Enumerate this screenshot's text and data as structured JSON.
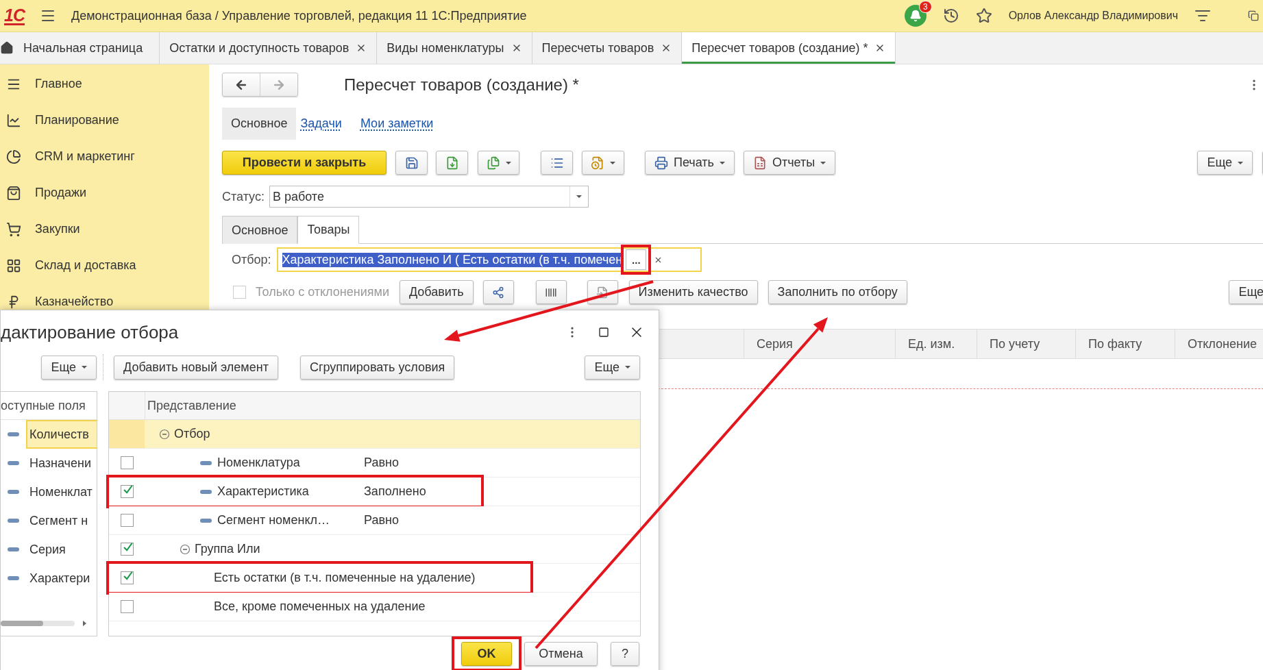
{
  "app_bar": {
    "logo": "1С",
    "title": "Демонстрационная база / Управление торговлей, редакция 11 1С:Предприятие",
    "notifications": "3",
    "user": "Орлов Александр Владимирович"
  },
  "open_tabs": [
    {
      "kind": "home",
      "label": "Начальная страница",
      "selected": false
    },
    {
      "kind": "document",
      "label": "Остатки и доступность товаров",
      "selected": false
    },
    {
      "kind": "document",
      "label": "Виды номенклатуры",
      "selected": false
    },
    {
      "kind": "document",
      "label": "Пересчеты товаров",
      "selected": false
    },
    {
      "kind": "document",
      "label": "Пересчет товаров (создание) *",
      "selected": true
    }
  ],
  "sidebar": {
    "items": [
      {
        "label": "Главное",
        "selected": false
      },
      {
        "label": "Планирование",
        "selected": false
      },
      {
        "label": "CRM и маркетинг",
        "selected": false
      },
      {
        "label": "Продажи",
        "selected": false
      },
      {
        "label": "Закупки",
        "selected": false
      },
      {
        "label": "Склад и доставка",
        "selected": false
      },
      {
        "label": "Казначейство",
        "selected": false
      }
    ]
  },
  "document": {
    "title": "Пересчет товаров (создание) *",
    "sections": [
      {
        "label": "Основное",
        "selected": true
      },
      {
        "label": "Задачи",
        "selected": false
      },
      {
        "label": "Мои заметки",
        "selected": false
      }
    ],
    "toolbar": {
      "post_and_close": "Провести и закрыть",
      "print": "Печать",
      "reports": "Отчеты",
      "more": "Еще"
    },
    "status": {
      "label": "Статус:",
      "value": "В работе"
    },
    "tabs": [
      {
        "label": "Основное",
        "selected": false
      },
      {
        "label": "Товары",
        "selected": true
      }
    ],
    "filter": {
      "label": "Отбор:",
      "value": "Характеристика Заполнено И ( Есть остатки (в т.ч. помечен",
      "selected": true,
      "choose": "...",
      "highlighted": true
    },
    "list_toolbar": {
      "only_deviations": {
        "label": "Только с отклонениями",
        "checked": false,
        "disabled": true
      },
      "add": "Добавить",
      "change_quality": "Изменить качество",
      "fill_by_filter": "Заполнить по отбору",
      "more": "Еще"
    },
    "columns": [
      "Серия",
      "Ед. изм.",
      "По учету",
      "По факту",
      "Отклонение"
    ]
  },
  "dialog": {
    "title": "дактирование отбора",
    "fields": {
      "more": "Еще",
      "header": "оступные поля",
      "items": [
        {
          "label": "Количеств",
          "selected": true
        },
        {
          "label": "Назначени",
          "selected": false
        },
        {
          "label": "Номенклат",
          "selected": false
        },
        {
          "label": "Сегмент н",
          "selected": false
        },
        {
          "label": "Серия",
          "selected": false
        },
        {
          "label": "Характери",
          "selected": false
        }
      ]
    },
    "toolbar": {
      "add": "Добавить новый элемент",
      "group": "Сгруппировать условия",
      "more": "Еще"
    },
    "tree": {
      "header": "Представление",
      "rows": [
        {
          "kind": "root",
          "label": "Отбор",
          "expanded": true,
          "selected": true,
          "children": [
            {
              "kind": "condition",
              "label": "Номенклатура",
              "condition": "Равно",
              "checked": false,
              "selected": false,
              "highlighted": false
            },
            {
              "kind": "condition",
              "label": "Характеристика",
              "condition": "Заполнено",
              "checked": true,
              "selected": false,
              "highlighted": true
            },
            {
              "kind": "condition",
              "label": "Сегмент номенкл…",
              "condition": "Равно",
              "checked": false,
              "selected": false,
              "highlighted": false
            },
            {
              "kind": "group",
              "label": "Группа Или",
              "checked": true,
              "expanded": true,
              "selected": false,
              "highlighted": false,
              "children": [
                {
                  "kind": "preset",
                  "label": "Есть остатки (в т.ч. помеченные на удаление)",
                  "checked": true,
                  "selected": false,
                  "highlighted": true
                },
                {
                  "kind": "preset",
                  "label": "Все, кроме помеченных на удаление",
                  "checked": false,
                  "selected": false,
                  "highlighted": false
                }
              ]
            }
          ]
        }
      ]
    },
    "buttons": {
      "ok": "OK",
      "ok_highlighted": true,
      "cancel": "Отмена",
      "help": "?"
    }
  }
}
